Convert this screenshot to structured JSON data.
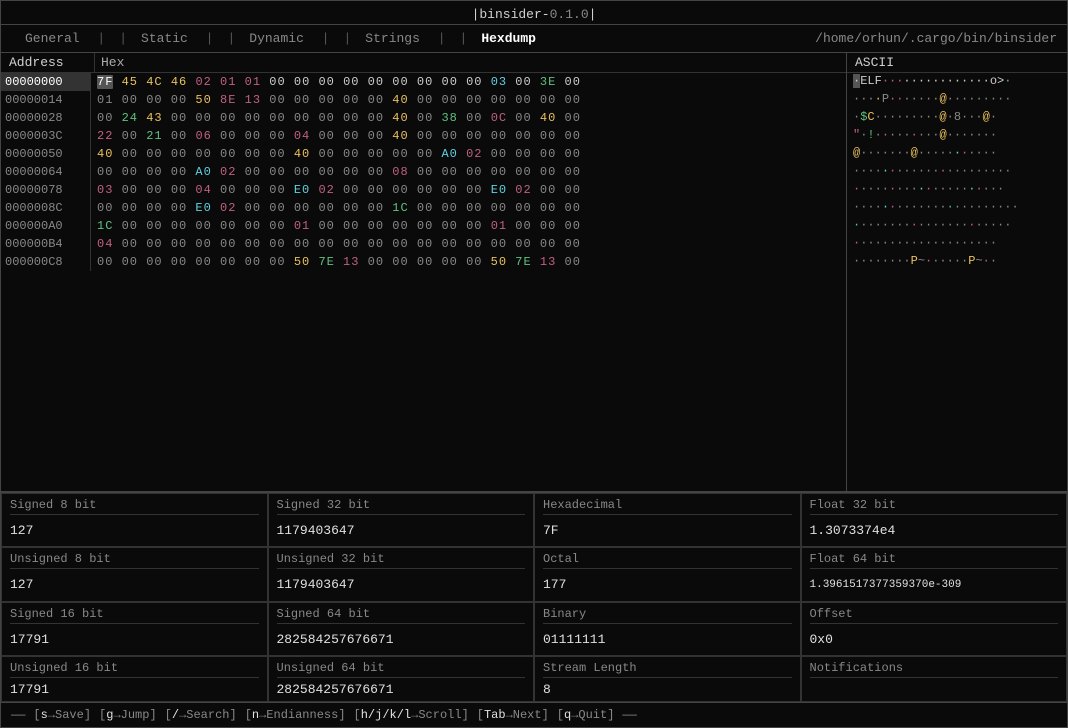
{
  "title": {
    "app_name": "binsider",
    "separator": "-",
    "version": "0.1.0",
    "path": "/home/orhun/.cargo/bin/binsider"
  },
  "nav": {
    "items": [
      {
        "label": "General",
        "active": false
      },
      {
        "label": "Static",
        "active": false
      },
      {
        "label": "Dynamic",
        "active": false
      },
      {
        "label": "Strings",
        "active": false
      },
      {
        "label": "Hexdump",
        "active": true
      }
    ]
  },
  "hex": {
    "address_header": "Address",
    "hex_header": "Hex",
    "ascii_header": "ASCII",
    "rows": [
      {
        "addr": "00000000",
        "data": "7F 45 4C 46 02 01 01 00 00 00 00 00 00 00 00 00 03 00 3E 00",
        "ascii": "·ELF·············>·",
        "selected": true
      },
      {
        "addr": "00000014",
        "data": "01 00 00 00 50 8E 13 00 00 00 00 00 40 00 00 00 00 00 00 00",
        "ascii": "····P···········@···",
        "selected": false
      },
      {
        "addr": "00000028",
        "data": "00 24 43 00 00 00 00 00 00 00 00 00 40 00 38 00 0C 00 40 00",
        "ascii": "·$C·········@·8···@·",
        "selected": false
      },
      {
        "addr": "0000003C",
        "data": "22 00 21 00 06 00 00 00 04 00 00 00 40 00 00 00 00 00 00 00",
        "ascii": "\"·!·······@·······",
        "selected": false
      },
      {
        "addr": "00000050",
        "data": "40 00 00 00 00 00 00 00 40 00 00 00 00 00 A0 02 00 00 00 00",
        "ascii": "@·······@·········",
        "selected": false
      },
      {
        "addr": "00000064",
        "data": "00 00 00 00 A0 02 00 00 00 00 00 00 08 00 00 00 00 00 00 00",
        "ascii": "····················",
        "selected": false
      },
      {
        "addr": "00000078",
        "data": "03 00 00 00 04 00 00 00 E0 02 00 00 00 00 00 00 E0 02 00 00",
        "ascii": "·····················",
        "selected": false
      },
      {
        "addr": "0000008C",
        "data": "00 00 00 00 E0 02 00 00 00 00 00 00 1C 00 00 00 00 00 00 00",
        "ascii": "····················",
        "selected": false
      },
      {
        "addr": "000000A0",
        "data": "1C 00 00 00 00 00 00 00 01 00 00 00 00 00 00 00 01 00 00 00",
        "ascii": "····················",
        "selected": false
      },
      {
        "addr": "000000B4",
        "data": "04 00 00 00 00 00 00 00 00 00 00 00 00 00 00 00 00 00 00 00",
        "ascii": "····················",
        "selected": false
      },
      {
        "addr": "000000C8",
        "data": "00 00 00 00 00 00 00 00 50 7E 13 00 00 00 00 00 50 7E 13 00",
        "ascii": "········P~······P~··",
        "selected": false
      }
    ]
  },
  "info_panels": [
    {
      "label": "Signed 8 bit",
      "value": "127"
    },
    {
      "label": "Signed 32 bit",
      "value": "1179403647"
    },
    {
      "label": "Hexadecimal",
      "value": "7F"
    },
    {
      "label": "Float 32 bit",
      "value": "1.3073374e4"
    },
    {
      "label": "Unsigned 8 bit",
      "value": "127"
    },
    {
      "label": "Unsigned 32 bit",
      "value": "1179403647"
    },
    {
      "label": "Octal",
      "value": "177"
    },
    {
      "label": "Float 64 bit",
      "value": "1.3961517377359370e-309"
    },
    {
      "label": "Signed 16 bit",
      "value": "17791"
    },
    {
      "label": "Signed 64 bit",
      "value": "282584257676671"
    },
    {
      "label": "Binary",
      "value": "01111111"
    },
    {
      "label": "Offset",
      "value": "0x0"
    },
    {
      "label": "Unsigned 16 bit",
      "value": "17791"
    },
    {
      "label": "Unsigned 64 bit",
      "value": "282584257676671"
    },
    {
      "label": "Stream Length",
      "value": "8"
    },
    {
      "label": "Notifications",
      "value": ""
    }
  ],
  "footer": {
    "items": [
      {
        "key": "s",
        "arrow": "→",
        "label": "Save"
      },
      {
        "key": "g",
        "arrow": "→",
        "label": "Jump"
      },
      {
        "key": "/",
        "arrow": "→",
        "label": "Search"
      },
      {
        "key": "n",
        "arrow": "→",
        "label": "Endianness"
      },
      {
        "key": "h/j/k/l",
        "arrow": "→",
        "label": "Scroll"
      },
      {
        "key": "Tab",
        "arrow": "→",
        "label": "Next"
      },
      {
        "key": "q",
        "arrow": "→",
        "label": "Quit"
      }
    ]
  }
}
